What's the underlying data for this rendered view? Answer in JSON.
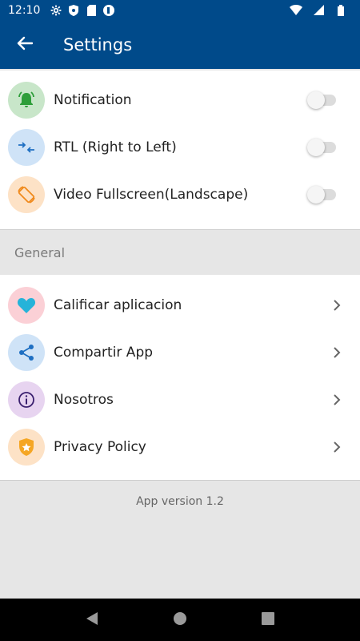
{
  "status_bar": {
    "time": "12:10",
    "left_icons": [
      "gear-icon",
      "shield-icon",
      "sd-card-icon",
      "app-icon"
    ],
    "right_icons": [
      "wifi-icon",
      "signal-icon",
      "battery-icon"
    ]
  },
  "app_bar": {
    "title": "Settings",
    "back_icon": "back-arrow-icon",
    "background": "#004a8a"
  },
  "toggles": [
    {
      "label": "Notification",
      "icon": "bell-icon",
      "icon_bg": "#c8e6c9",
      "icon_color": "#2e9e3a",
      "on": false
    },
    {
      "label": "RTL (Right to Left)",
      "icon": "swap-arrows-icon",
      "icon_bg": "#cfe3f7",
      "icon_color": "#1e6fc2",
      "on": false
    },
    {
      "label": "Video Fullscreen(Landscape)",
      "icon": "rotate-screen-icon",
      "icon_bg": "#fde2c6",
      "icon_color": "#f08a1c",
      "on": false
    }
  ],
  "section": {
    "title": "General"
  },
  "links": [
    {
      "label": "Calificar aplicacion",
      "icon": "heart-icon",
      "icon_bg": "#fbd0d6",
      "icon_color": "#26b3d9"
    },
    {
      "label": "Compartir App",
      "icon": "share-icon",
      "icon_bg": "#cfe3f7",
      "icon_color": "#1e6fc2"
    },
    {
      "label": "Nosotros",
      "icon": "info-icon",
      "icon_bg": "#e7d4f0",
      "icon_color": "#3a1f6e"
    },
    {
      "label": "Privacy Policy",
      "icon": "shield-star-icon",
      "icon_bg": "#fde2c6",
      "icon_color": "#f5a623"
    }
  ],
  "footer": {
    "version": "App version 1.2"
  },
  "nav_bar": {
    "buttons": [
      "back-triangle-icon",
      "home-circle-icon",
      "recents-square-icon"
    ]
  }
}
